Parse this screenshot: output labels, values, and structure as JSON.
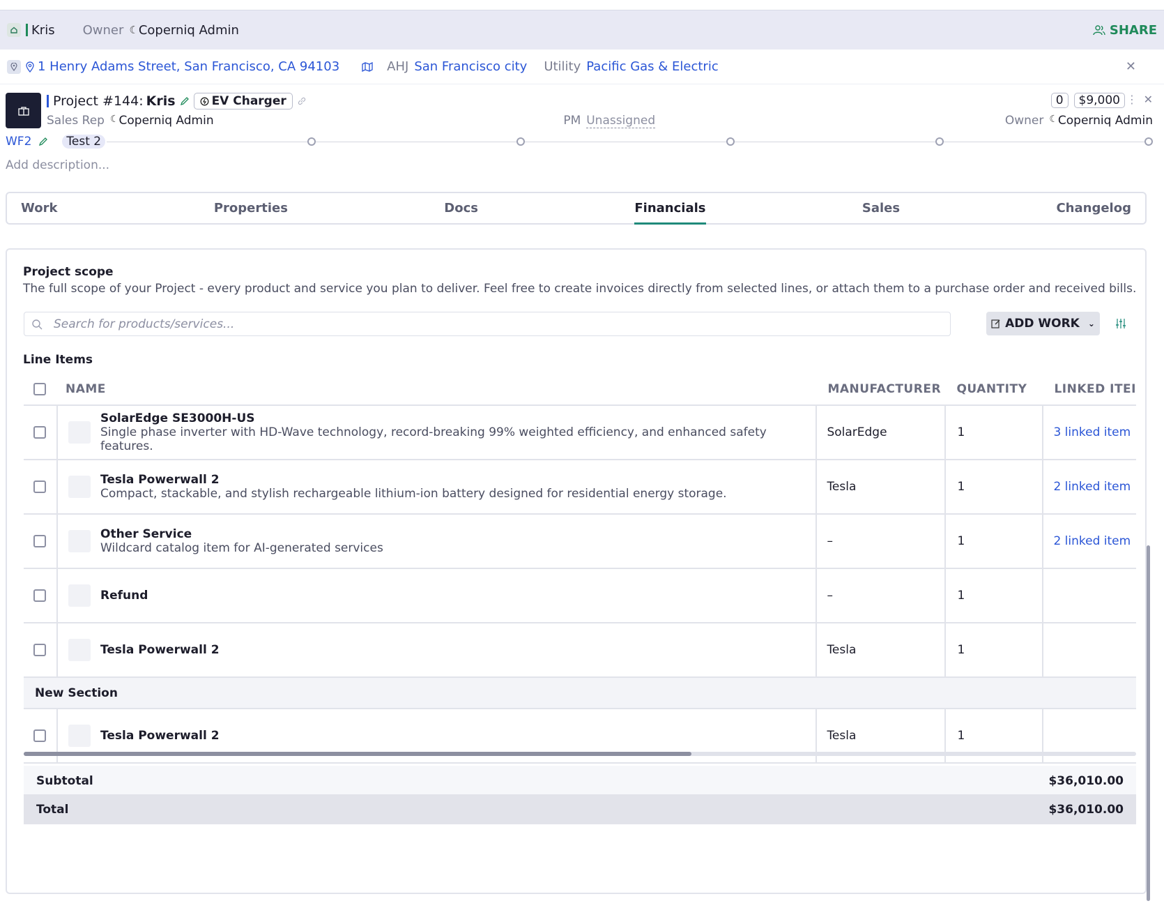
{
  "topbar": {
    "name": "Kris",
    "owner_label": "Owner",
    "owner_name": "Coperniq Admin",
    "share_label": "SHARE"
  },
  "address_bar": {
    "address": "1 Henry Adams Street, San Francisco, CA 94103",
    "ahj_label": "AHJ",
    "ahj_value": "San Francisco city",
    "utility_label": "Utility",
    "utility_value": "Pacific Gas & Electric"
  },
  "project": {
    "title_prefix": "Project #144:",
    "title_name": "Kris",
    "type_badge": "EV Charger",
    "count": "0",
    "amount": "$9,000",
    "sales_rep_label": "Sales Rep",
    "sales_rep": "Coperniq Admin",
    "pm_label": "PM",
    "pm_value": "Unassigned",
    "owner_label": "Owner",
    "owner_name": "Coperniq Admin",
    "workflow": "WF2",
    "stage": "Test 2",
    "description_placeholder": "Add description..."
  },
  "tabs": [
    "Work",
    "Properties",
    "Docs",
    "Financials",
    "Sales",
    "Changelog"
  ],
  "scope": {
    "title": "Project scope",
    "subtitle": "The full scope of your Project - every product and service you plan to deliver. Feel free to create invoices directly from selected lines, or attach them to a purchase order and received bills.",
    "search_placeholder": "Search for products/services...",
    "add_work_label": "ADD WORK",
    "line_items_title": "Line Items",
    "columns": [
      "NAME",
      "MANUFACTURER",
      "QUANTITY",
      "LINKED ITEI"
    ],
    "rows": [
      {
        "name": "SolarEdge SE3000H-US",
        "desc": "Single phase inverter with HD-Wave technology, record-breaking 99% weighted efficiency, and enhanced safety features.",
        "manufacturer": "SolarEdge",
        "quantity": "1",
        "linked": "3 linked item"
      },
      {
        "name": "Tesla Powerwall 2",
        "desc": "Compact, stackable, and stylish rechargeable lithium-ion battery designed for residential energy storage.",
        "manufacturer": "Tesla",
        "quantity": "1",
        "linked": "2 linked item"
      },
      {
        "name": "Other Service",
        "desc": "Wildcard catalog item for AI-generated services",
        "manufacturer": "–",
        "quantity": "1",
        "linked": "2 linked item"
      },
      {
        "name": "Refund",
        "desc": "",
        "manufacturer": "–",
        "quantity": "1",
        "linked": ""
      },
      {
        "name": "Tesla Powerwall 2",
        "desc": "",
        "manufacturer": "Tesla",
        "quantity": "1",
        "linked": ""
      }
    ],
    "section_name": "New Section",
    "section_rows": [
      {
        "name": "Tesla Powerwall 2",
        "desc": "",
        "manufacturer": "Tesla",
        "quantity": "1",
        "linked": ""
      }
    ],
    "subtotal_label": "Subtotal",
    "subtotal_value": "$36,010.00",
    "total_label": "Total",
    "total_value": "$36,010.00"
  }
}
